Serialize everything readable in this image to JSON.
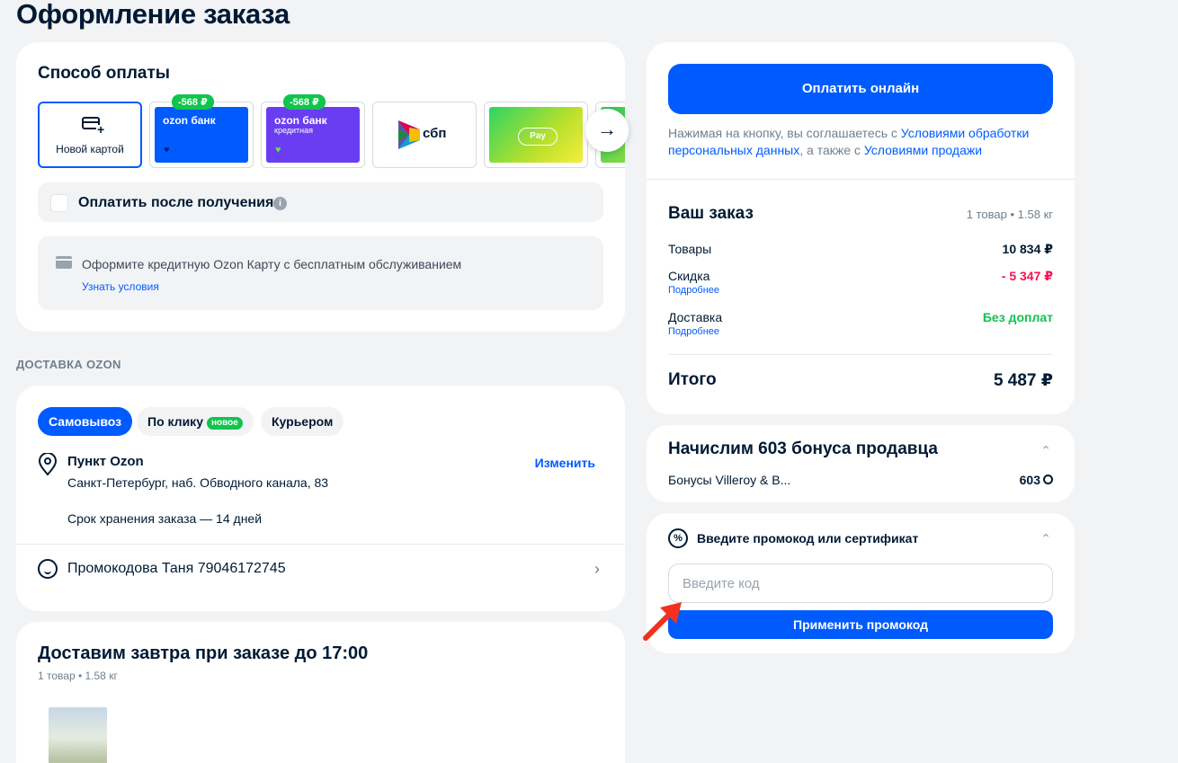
{
  "page": {
    "title": "Оформление заказа"
  },
  "payment": {
    "title": "Способ оплаты",
    "methods": [
      {
        "label": "Новой картой"
      },
      {
        "bank": "ozon банк",
        "badge": "-568 ₽"
      },
      {
        "bank": "ozon банк",
        "sub": "кредитная",
        "badge": "-568 ₽"
      },
      {
        "label": "сбп"
      },
      {
        "label": "Pay"
      }
    ],
    "pay_after": "Оплатить после получения",
    "credit_offer": {
      "text": "Оформите кредитную Ozon Карту с бесплатным обслуживанием",
      "link": "Узнать условия"
    }
  },
  "delivery": {
    "section": "ДОСТАВКА OZON",
    "tabs": [
      "Самовывоз",
      "По клику",
      "Курьером"
    ],
    "tab_badge": "новое",
    "point_title": "Пункт Ozon",
    "change": "Изменить",
    "address": "Санкт-Петербург, наб. Обводного канала, 83",
    "storage": "Срок хранения заказа — 14 дней",
    "promo_person": "Промокодова Таня 79046172745"
  },
  "shipment": {
    "title": "Доставим завтра при заказе до 17:00",
    "meta": "1 товар • 1.58 кг"
  },
  "checkout": {
    "pay_button": "Оплатить онлайн",
    "consent_1": "Нажимая на кнопку, вы соглашаетесь с ",
    "consent_link_1": "Условиями обработки персональных данных",
    "consent_2": ", а также с ",
    "consent_link_2": "Условиями продажи",
    "order_title": "Ваш заказ",
    "order_meta": "1 товар • 1.58 кг",
    "goods_label": "Товары",
    "goods_value": "10 834 ₽",
    "discount_label": "Скидка",
    "discount_more": "Подробнее",
    "discount_value": "- 5 347 ₽",
    "shipping_label": "Доставка",
    "shipping_more": "Подробнее",
    "shipping_value": "Без доплат",
    "total_label": "Итого",
    "total_value": "5 487 ₽"
  },
  "bonus": {
    "title": "Начислим 603 бонуса продавца",
    "label": "Бонусы Villeroy & B...",
    "value": "603"
  },
  "promo": {
    "title": "Введите промокод или сертификат",
    "placeholder": "Введите код",
    "apply": "Применить промокод"
  },
  "colors": {
    "accent": "#005bff",
    "success": "#10c44c",
    "discount": "#f91155",
    "annotation": "#f1311e"
  },
  "icons": [
    "card-plus-icon",
    "heart-icon",
    "sbp-logo-icon",
    "arrow-right-icon",
    "info-icon",
    "credit-card-icon",
    "location-pin-icon",
    "smile-icon",
    "chevron-right-icon",
    "chevron-up-icon",
    "bonus-coin-icon",
    "percent-icon",
    "red-arrow-icon"
  ]
}
